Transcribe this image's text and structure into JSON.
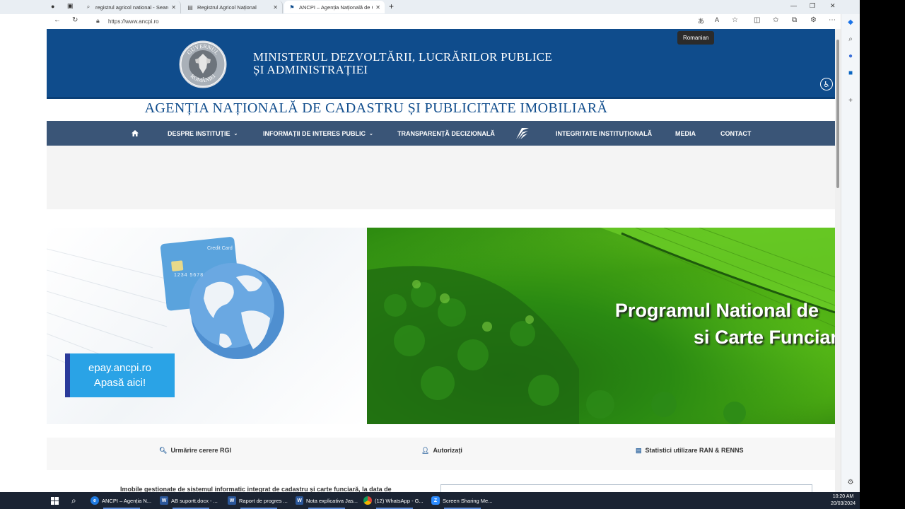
{
  "tabs": [
    {
      "title": "registrul agricol national - Searc",
      "icon": "search-icon",
      "active": false
    },
    {
      "title": "Registrul Agricol Național",
      "icon": "document-icon",
      "active": false
    },
    {
      "title": "ANCPI – Agenția Națională de C",
      "icon": "ancpi-favicon",
      "active": true
    }
  ],
  "address_bar": {
    "url": "https://www.ancpi.ro"
  },
  "tooltip": "Romanian",
  "header": {
    "ministry_line1": "MINISTERUL DEZVOLTĂRII, LUCRĂRILOR PUBLICE",
    "ministry_line2": "ȘI ADMINISTRAȚIEI",
    "emblem_top_text": "GUVERNUL",
    "emblem_bottom_text": "ROMÂNIEI",
    "agency_title": "AGENȚIA NAȚIONALĂ DE CADASTRU ȘI PUBLICITATE IMOBILIARĂ"
  },
  "nav": {
    "home_icon": "home-icon",
    "items": [
      {
        "label": "DESPRE INSTITUȚIE",
        "dropdown": true
      },
      {
        "label": "INFORMAȚII DE INTERES PUBLIC",
        "dropdown": true
      },
      {
        "label": "TRANSPARENȚĂ DECIZIONALĂ",
        "dropdown": false
      },
      {
        "label": "INTEGRITATE INSTITUȚIONALĂ",
        "dropdown": false
      },
      {
        "label": "MEDIA",
        "dropdown": false
      },
      {
        "label": "CONTACT",
        "dropdown": false
      }
    ]
  },
  "banners": {
    "epay_line1": "epay.ancpi.ro",
    "epay_line2": "Apasă aici!",
    "card_text": "Credit Card",
    "card_number": "1234 5678",
    "program_line1": "Programul National de",
    "program_line2": "si Carte Funciar"
  },
  "quick_links": [
    {
      "label": "Urmărire cerere RGI",
      "icon": "search-icon"
    },
    {
      "label": "Autorizați",
      "icon": "user-icon"
    },
    {
      "label": "Statistici utilizare RAN & RENNS",
      "icon": "document-icon"
    }
  ],
  "bottom_text": "Imobile gestionate de sistemul informatic integrat de cadastru și carte funciară, la data de",
  "taskbar": {
    "apps": [
      {
        "label": "ANCPI – Agenția N...",
        "icon": "edge-icon",
        "color": "#1f7ae0"
      },
      {
        "label": "AB suportt.docx - ...",
        "icon": "word-icon",
        "color": "#2b579a"
      },
      {
        "label": "Raport de progres ...",
        "icon": "word-icon",
        "color": "#2b579a"
      },
      {
        "label": "Nota explicativa Jas...",
        "icon": "word-icon",
        "color": "#2b579a"
      },
      {
        "label": "(12) WhatsApp - G...",
        "icon": "chrome-icon",
        "color": "#e0a020"
      },
      {
        "label": "Screen Sharing Me...",
        "icon": "zoom-icon",
        "color": "#2d8cff"
      }
    ],
    "time": "10:20 AM",
    "date": "20/03/2024"
  },
  "colors": {
    "header_blue": "#0f4c8c",
    "nav_bg": "#3a5577",
    "epay_blue": "#2aa3e6"
  }
}
